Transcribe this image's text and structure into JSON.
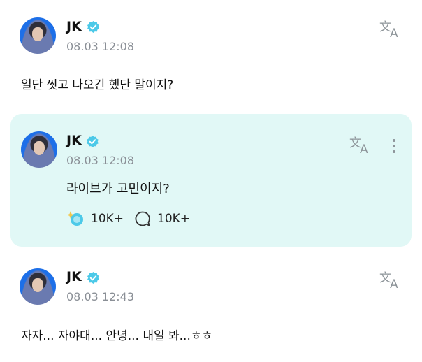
{
  "posts": [
    {
      "author": "JK",
      "time": "08.03 12:08",
      "text": "일단 씻고 나오긴 했단 말이지?"
    },
    {
      "author": "JK",
      "time": "08.03 12:08",
      "text": "라이브가 고민이지?",
      "likes": "10K+",
      "comments": "10K+"
    },
    {
      "author": "JK",
      "time": "08.03 12:43",
      "text": "자자... 자야대... 안녕... 내일 봐...ㅎㅎ"
    }
  ],
  "icons": {
    "translate": "translate-icon",
    "verified": "verified-badge-icon",
    "more": "more-vertical-icon",
    "like": "sparkle-like-icon",
    "comment": "comment-bubble-icon"
  },
  "colors": {
    "accent": "#4cc9e8",
    "card": "#e1f8f6",
    "muted": "#8a8f96",
    "avatar_bg": "#1d6fe8"
  }
}
